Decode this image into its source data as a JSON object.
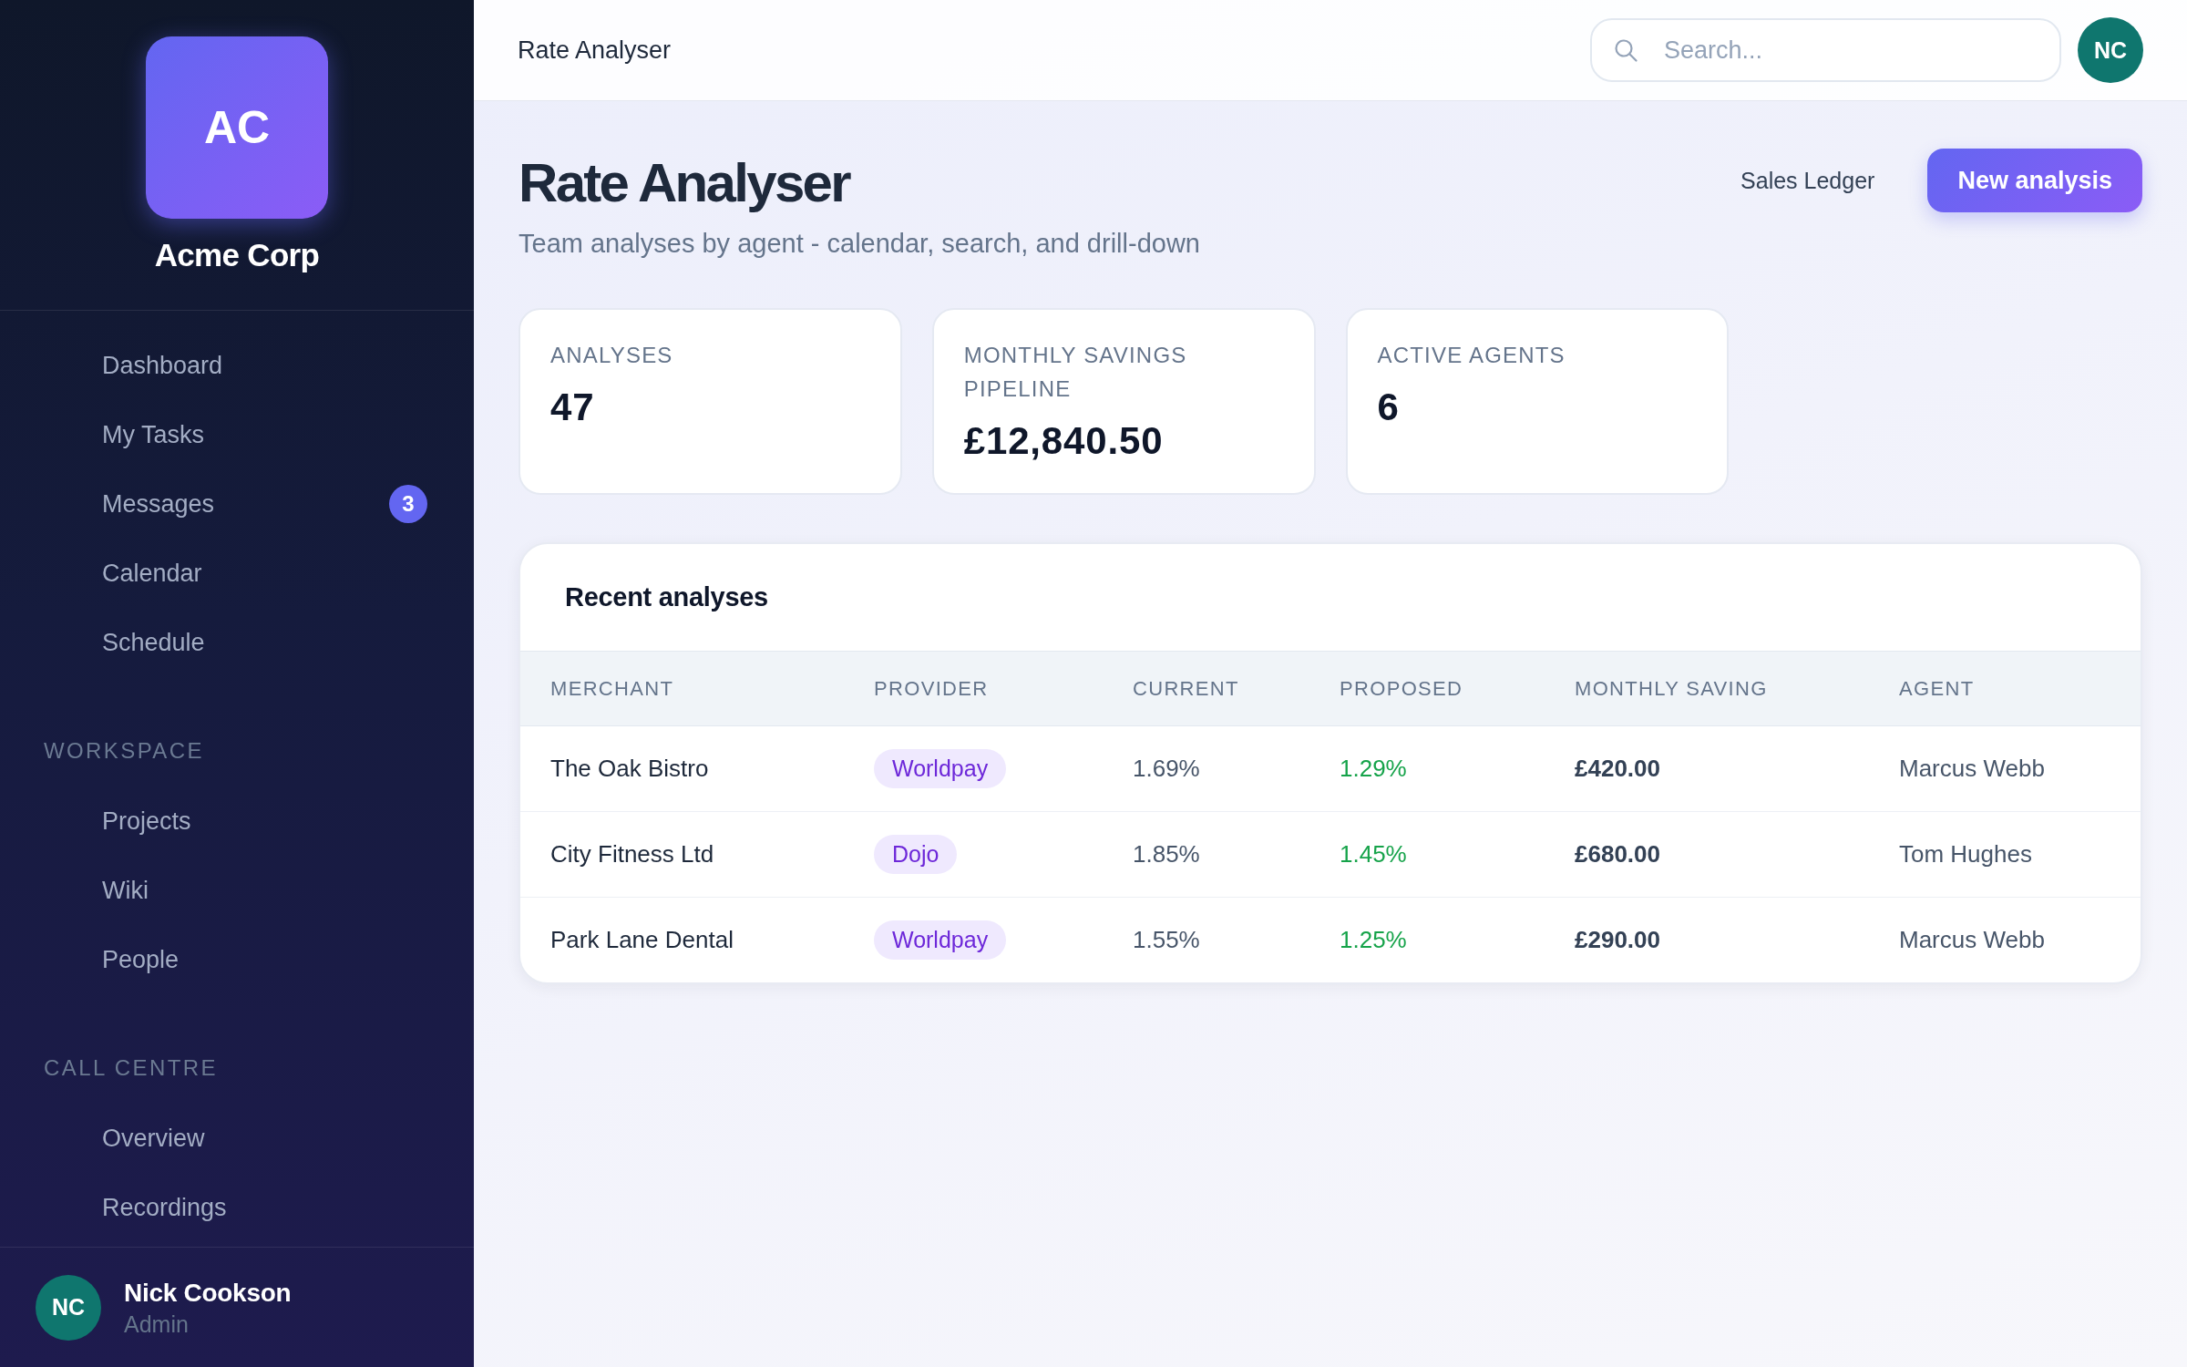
{
  "sidebar": {
    "logo": "AC",
    "company": "Acme Corp",
    "sections": [
      {
        "items": [
          {
            "label": "Dashboard",
            "selected": false
          },
          {
            "label": "My Tasks",
            "selected": false
          },
          {
            "label": "Messages",
            "selected": false,
            "badge": "3"
          },
          {
            "label": "Calendar",
            "selected": false
          },
          {
            "label": "Schedule",
            "selected": false
          }
        ]
      },
      {
        "heading": "WORKSPACE",
        "items": [
          {
            "label": "Projects",
            "selected": false
          },
          {
            "label": "Wiki",
            "selected": false
          },
          {
            "label": "People",
            "selected": false
          }
        ]
      },
      {
        "heading": "CALL CENTRE",
        "items": [
          {
            "label": "Overview",
            "selected": false
          },
          {
            "label": "Recordings",
            "selected": false
          }
        ]
      }
    ],
    "user": {
      "initials": "NC",
      "name": "Nick Cookson",
      "role": "Admin"
    }
  },
  "topbar": {
    "title": "Rate Analyser",
    "search": {
      "placeholder": "Search..."
    },
    "avatar": "NC"
  },
  "header": {
    "title": "Rate Analyser",
    "subtitle": "Team analyses by agent - calendar, search, and drill-down",
    "actions": [
      {
        "label": "Sales Ledger",
        "kind": "ghost"
      },
      {
        "label": "New analysis",
        "kind": "primary"
      }
    ]
  },
  "stats": [
    {
      "label": "ANALYSES",
      "value": "47"
    },
    {
      "label": "MONTHLY SAVINGS PIPELINE",
      "value": "£12,840.50"
    },
    {
      "label": "ACTIVE AGENTS",
      "value": "6"
    }
  ],
  "table": {
    "title": "Recent analyses",
    "columns": [
      "MERCHANT",
      "PROVIDER",
      "CURRENT",
      "PROPOSED",
      "MONTHLY SAVING",
      "AGENT"
    ],
    "rows": [
      {
        "merchant": "The Oak Bistro",
        "provider": "Worldpay",
        "current": "1.69%",
        "proposed": "1.29%",
        "monthly_saving": "£420.00",
        "agent": "Marcus Webb"
      },
      {
        "merchant": "City Fitness Ltd",
        "provider": "Dojo",
        "current": "1.85%",
        "proposed": "1.45%",
        "monthly_saving": "£680.00",
        "agent": "Tom Hughes"
      },
      {
        "merchant": "Park Lane Dental",
        "provider": "Worldpay",
        "current": "1.55%",
        "proposed": "1.25%",
        "monthly_saving": "£290.00",
        "agent": "Marcus Webb"
      }
    ]
  }
}
